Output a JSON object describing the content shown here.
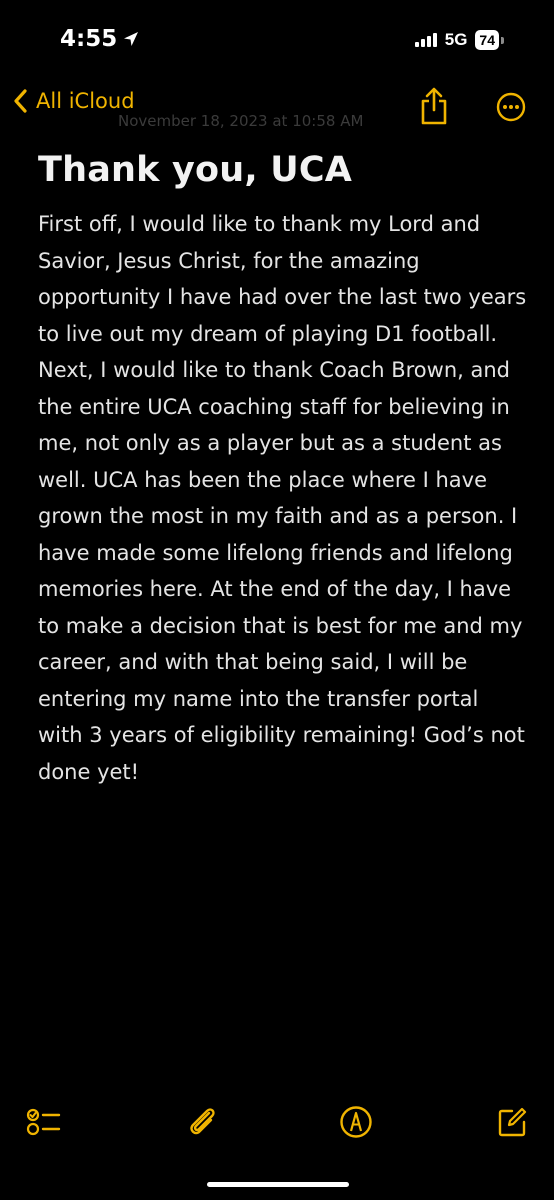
{
  "status_bar": {
    "time": "4:55",
    "network": "5G",
    "battery": "74"
  },
  "nav": {
    "back_label": "All iCloud",
    "date_text": "November 18, 2023 at 10:58 AM"
  },
  "note": {
    "title": "Thank you, UCA",
    "body": "First off, I would like to thank my Lord and Savior, Jesus Christ, for the amazing opportunity I have had over the last two years to live out my dream of playing D1 football. Next, I would like to thank Coach Brown, and the entire UCA coaching staff for believing in me, not only as a player but as a student as well. UCA has been the place where I have grown the most in my faith and as a person. I have made some lifelong friends and lifelong memories here. At the end of the day, I have to make a decision that is best for me and my career, and with that being said, I will be entering my name into the transfer portal with 3 years of eligibility remaining!  God’s not done yet!"
  },
  "toolbar": {
    "icons": [
      "checklist-icon",
      "paperclip-icon",
      "markup-icon",
      "compose-icon"
    ]
  },
  "colors": {
    "accent": "#f0b400",
    "background": "#000000",
    "text": "#e4e4e4"
  }
}
